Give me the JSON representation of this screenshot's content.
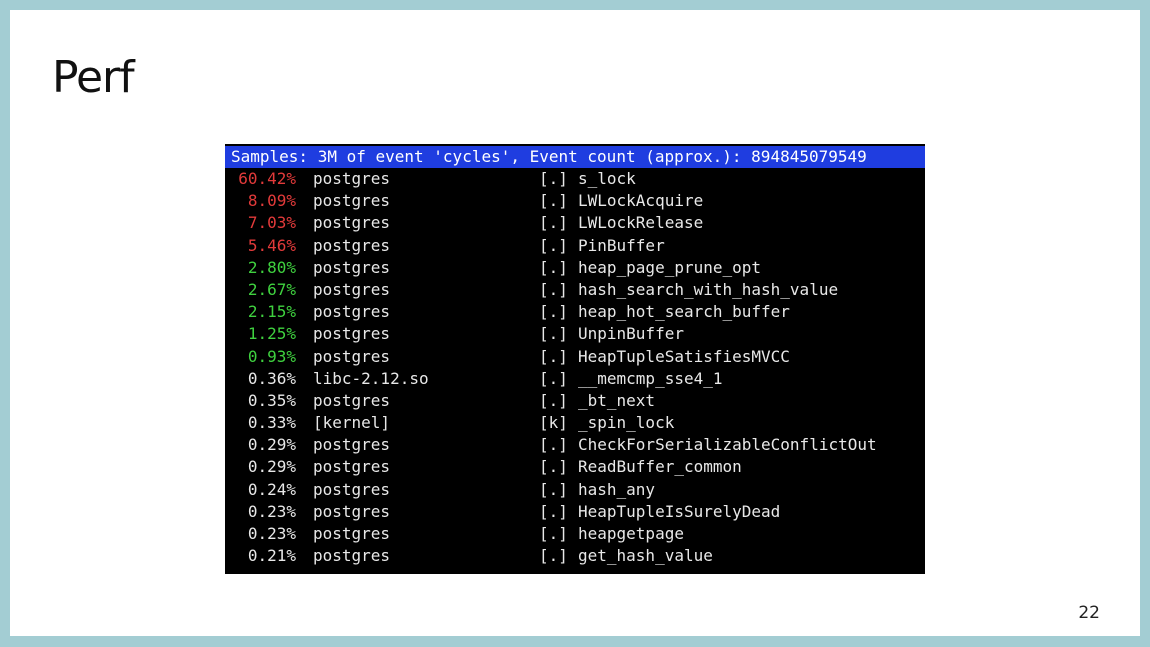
{
  "slide": {
    "title": "Perf",
    "page_number": "22"
  },
  "colors": {
    "frame": "#a3cdd3",
    "header_bg": "#1f3de0",
    "hot": "#e23a3a",
    "warm": "#3fd13f",
    "normal": "#e8e8e8"
  },
  "terminal": {
    "header": "Samples: 3M of event 'cycles', Event count (approx.): 894845079549",
    "rows": [
      {
        "pct": "60.42%",
        "proc": "postgres",
        "mode": "[.]",
        "sym": "s_lock",
        "level": "red"
      },
      {
        "pct": "8.09%",
        "proc": "postgres",
        "mode": "[.]",
        "sym": "LWLockAcquire",
        "level": "red"
      },
      {
        "pct": "7.03%",
        "proc": "postgres",
        "mode": "[.]",
        "sym": "LWLockRelease",
        "level": "red"
      },
      {
        "pct": "5.46%",
        "proc": "postgres",
        "mode": "[.]",
        "sym": "PinBuffer",
        "level": "red"
      },
      {
        "pct": "2.80%",
        "proc": "postgres",
        "mode": "[.]",
        "sym": "heap_page_prune_opt",
        "level": "green"
      },
      {
        "pct": "2.67%",
        "proc": "postgres",
        "mode": "[.]",
        "sym": "hash_search_with_hash_value",
        "level": "green"
      },
      {
        "pct": "2.15%",
        "proc": "postgres",
        "mode": "[.]",
        "sym": "heap_hot_search_buffer",
        "level": "green"
      },
      {
        "pct": "1.25%",
        "proc": "postgres",
        "mode": "[.]",
        "sym": "UnpinBuffer",
        "level": "green"
      },
      {
        "pct": "0.93%",
        "proc": "postgres",
        "mode": "[.]",
        "sym": "HeapTupleSatisfiesMVCC",
        "level": "green"
      },
      {
        "pct": "0.36%",
        "proc": "libc-2.12.so",
        "mode": "[.]",
        "sym": "__memcmp_sse4_1",
        "level": "white"
      },
      {
        "pct": "0.35%",
        "proc": "postgres",
        "mode": "[.]",
        "sym": "_bt_next",
        "level": "white"
      },
      {
        "pct": "0.33%",
        "proc": "[kernel]",
        "mode": "[k]",
        "sym": "_spin_lock",
        "level": "white"
      },
      {
        "pct": "0.29%",
        "proc": "postgres",
        "mode": "[.]",
        "sym": "CheckForSerializableConflictOut",
        "level": "white"
      },
      {
        "pct": "0.29%",
        "proc": "postgres",
        "mode": "[.]",
        "sym": "ReadBuffer_common",
        "level": "white"
      },
      {
        "pct": "0.24%",
        "proc": "postgres",
        "mode": "[.]",
        "sym": "hash_any",
        "level": "white"
      },
      {
        "pct": "0.23%",
        "proc": "postgres",
        "mode": "[.]",
        "sym": "HeapTupleIsSurelyDead",
        "level": "white"
      },
      {
        "pct": "0.23%",
        "proc": "postgres",
        "mode": "[.]",
        "sym": "heapgetpage",
        "level": "white"
      },
      {
        "pct": "0.21%",
        "proc": "postgres",
        "mode": "[.]",
        "sym": "get_hash_value",
        "level": "white"
      }
    ]
  }
}
